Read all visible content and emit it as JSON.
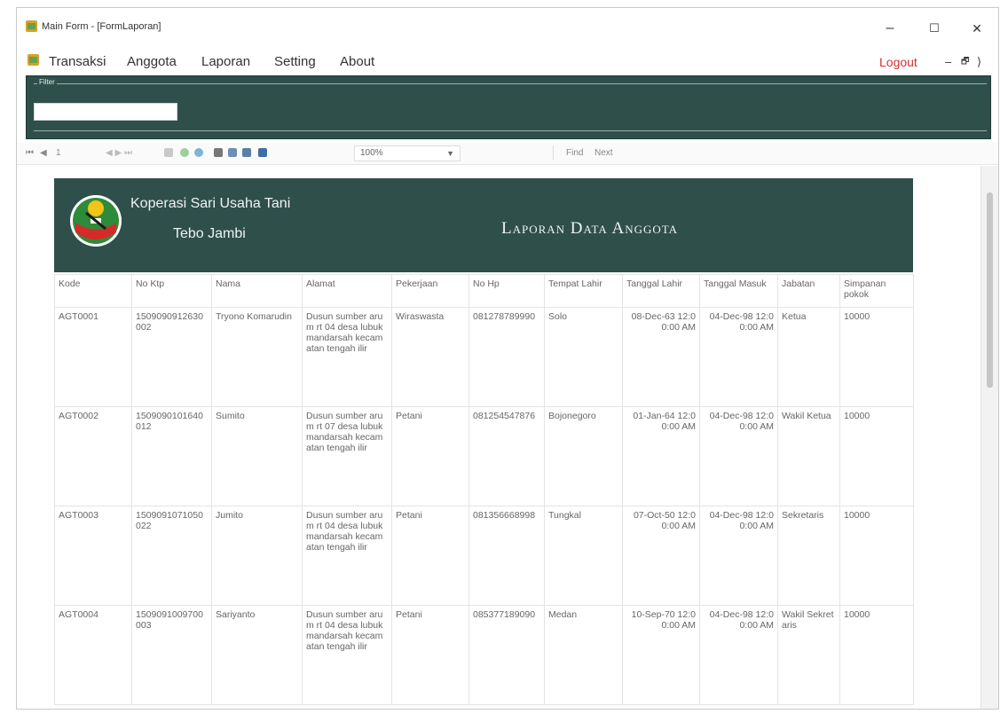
{
  "window": {
    "title": "Main Form - [FormLaporan]",
    "minimize": "–",
    "maximize": "☐",
    "close": "✕"
  },
  "menu": {
    "items": [
      "Transaksi",
      "Anggota",
      "Laporan",
      "Setting",
      "About"
    ],
    "logout": "Logout",
    "mdi_min": "–",
    "mdi_restore": "🗗",
    "mdi_close": "⟩"
  },
  "filter": {
    "legend": "Filter",
    "value": ""
  },
  "toolbar": {
    "first": "⏮",
    "prev": "◀",
    "page": "1",
    "zoom": "100%",
    "find": "Find",
    "next": "Next"
  },
  "report": {
    "org_name": "Koperasi Sari Usaha Tani",
    "org_city": "Tebo Jambi",
    "title": "Laporan Data Anggota",
    "columns": [
      "Kode",
      "No Ktp",
      "Nama",
      "Alamat",
      "Pekerjaan",
      "No Hp",
      "Tempat Lahir",
      "Tanggal Lahir",
      "Tanggal Masuk",
      "Jabatan",
      "Simpanan pokok"
    ],
    "rows": [
      {
        "kode": "AGT0001",
        "ktp": "1509090912630002",
        "nama": "Tryono Komarudin",
        "alamat": "Dusun sumber arum rt 04 desa lubuk mandarsah kecamatan tengah ilir",
        "pekerjaan": "Wiraswasta",
        "hp": "081278789990",
        "tempat": "Solo",
        "tgl_lahir": "08-Dec-63 12:00:00 AM",
        "tgl_masuk": "04-Dec-98 12:00:00 AM",
        "jabatan": "Ketua",
        "simpanan": "10000"
      },
      {
        "kode": "AGT0002",
        "ktp": "1509090101640012",
        "nama": "Sumito",
        "alamat": "Dusun sumber arum rt 07 desa lubuk mandarsah kecamatan tengah ilir",
        "pekerjaan": "Petani",
        "hp": "081254547876",
        "tempat": "Bojonegoro",
        "tgl_lahir": "01-Jan-64 12:00:00 AM",
        "tgl_masuk": "04-Dec-98 12:00:00 AM",
        "jabatan": "Wakil Ketua",
        "simpanan": "10000"
      },
      {
        "kode": "AGT0003",
        "ktp": "1509091071050022",
        "nama": "Jumito",
        "alamat": "Dusun sumber arum rt 04 desa lubuk mandarsah kecamatan tengah ilir",
        "pekerjaan": "Petani",
        "hp": "081356668998",
        "tempat": "Tungkal",
        "tgl_lahir": "07-Oct-50 12:00:00 AM",
        "tgl_masuk": "04-Dec-98 12:00:00 AM",
        "jabatan": "Sekretaris",
        "simpanan": "10000"
      },
      {
        "kode": "AGT0004",
        "ktp": "1509091009700003",
        "nama": "Sariyanto",
        "alamat": "Dusun sumber arum rt 04 desa lubuk mandarsah kecamatan tengah ilir",
        "pekerjaan": "Petani",
        "hp": "085377189090",
        "tempat": "Medan",
        "tgl_lahir": "10-Sep-70 12:00:00 AM",
        "tgl_masuk": "04-Dec-98 12:00:00 AM",
        "jabatan": "Wakil Sekretaris",
        "simpanan": "10000"
      }
    ]
  },
  "colors": {
    "header_bg": "#2f4f4b",
    "logout": "#d9302c"
  }
}
